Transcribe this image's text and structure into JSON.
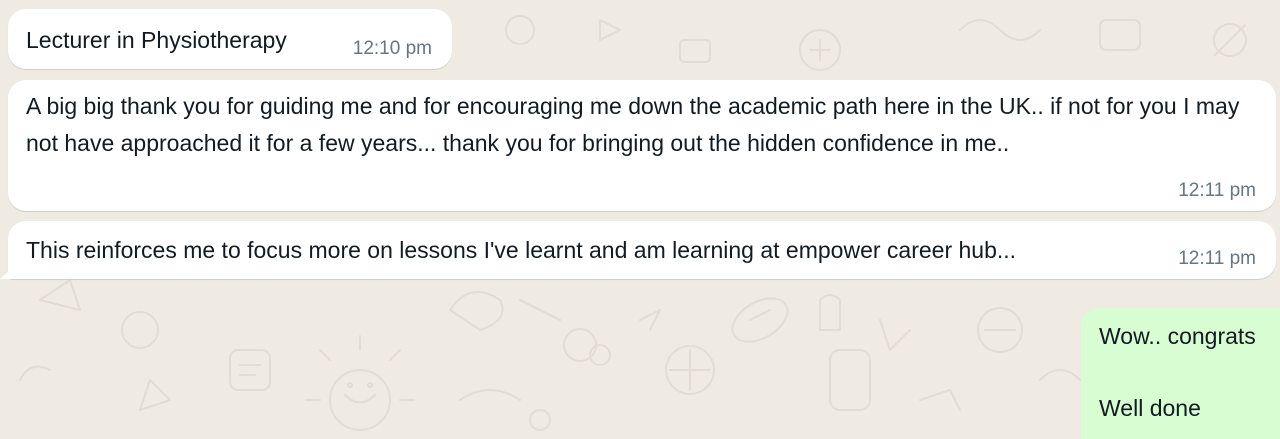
{
  "theme": {
    "background": "#efeae2",
    "incoming_bubble": "#ffffff",
    "outgoing_bubble": "#d9fdd3",
    "text_color": "#111b21",
    "time_color": "#667781"
  },
  "messages": [
    {
      "direction": "incoming",
      "text": "Lecturer in Physiotherapy",
      "time": "12:10 pm"
    },
    {
      "direction": "incoming",
      "text": "A big big thank you for guiding me and for encouraging me down the academic path here in the UK.. if not for you I may not have approached it for a few years... thank you for bringing out the hidden confidence in me..",
      "time": "12:11 pm"
    },
    {
      "direction": "incoming",
      "text": "This reinforces me to focus more on lessons I've learnt and am learning at empower career hub...",
      "time": "12:11 pm"
    },
    {
      "direction": "outgoing",
      "lines": [
        "Wow.. congrats",
        "Well done"
      ]
    }
  ]
}
